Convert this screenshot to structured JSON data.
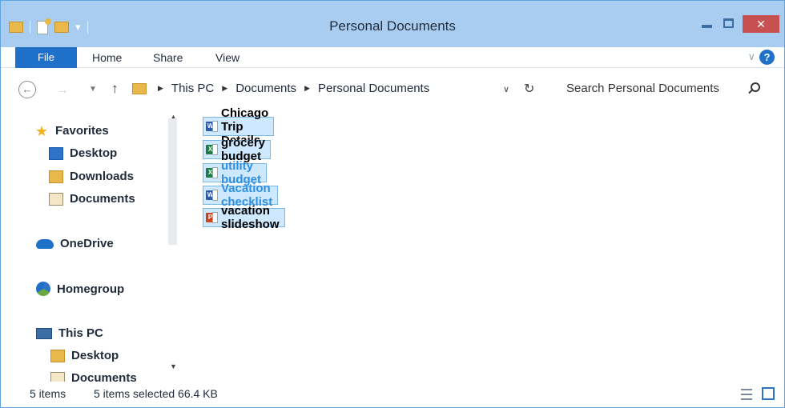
{
  "window": {
    "title": "Personal Documents",
    "close_label": "✕"
  },
  "ribbon": {
    "file": "File",
    "home": "Home",
    "share": "Share",
    "view": "View",
    "help": "?"
  },
  "address": {
    "crumbs": [
      "This PC",
      "Documents",
      "Personal Documents"
    ],
    "search_placeholder": "Search Personal Documents"
  },
  "nav_pane": {
    "favorites": "Favorites",
    "desktop": "Desktop",
    "downloads": "Downloads",
    "documents": "Documents",
    "onedrive": "OneDrive",
    "homegroup": "Homegroup",
    "this_pc": "This PC",
    "pc_desktop": "Desktop",
    "pc_documents": "Documents"
  },
  "files": [
    {
      "name": "Chicago Trip Details",
      "type": "word",
      "badge": "W"
    },
    {
      "name": "grocery budget",
      "type": "excel",
      "badge": "X"
    },
    {
      "name": "utility budget",
      "type": "excel",
      "badge": "X"
    },
    {
      "name": "Vacation checklist",
      "type": "word",
      "badge": "W"
    },
    {
      "name": "vacation slideshow",
      "type": "ppt",
      "badge": "P"
    }
  ],
  "status": {
    "count": "5 items",
    "selection": "5 items selected  66.4 KB"
  },
  "colors": {
    "titlebar": "#a9cdf0",
    "file_tab": "#1e70c8",
    "selection": "#cde8ff",
    "close": "#c75050"
  }
}
